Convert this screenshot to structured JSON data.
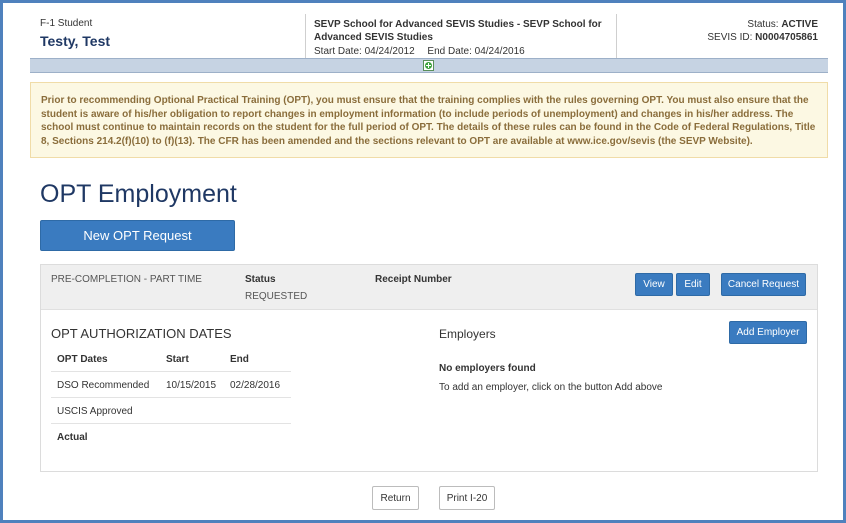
{
  "student": {
    "type": "F-1 Student",
    "name": "Testy, Test"
  },
  "school": {
    "name_line1": "SEVP School for Advanced SEVIS Studies - SEVP School for",
    "name_line2": "Advanced SEVIS Studies",
    "start_date": "Start Date: 04/24/2012",
    "end_date": "End Date: 04/24/2016"
  },
  "status": {
    "label": "Status:",
    "value": "ACTIVE",
    "sevis_label": "SEVIS ID:",
    "sevis_id": "N0004705861"
  },
  "notice": "Prior to recommending Optional Practical Training (OPT), you must ensure that the training complies with the rules governing OPT. You must also ensure that the student is aware of his/her obligation to report changes in employment information (to include periods of unemployment) and changes in his/her address. The school must continue to maintain records on the student for the full period of OPT. The details of these rules can be found in the Code of Federal Regulations, Title 8, Sections 214.2(f)(10) to (f)(13). The CFR has been amended and the sections relevant to OPT are available at www.ice.gov/sevis (the SEVP Website).",
  "page_title": "OPT Employment",
  "new_request_label": "New OPT Request",
  "request": {
    "type": "PRE-COMPLETION - PART TIME",
    "status_label": "Status",
    "status_value": "REQUESTED",
    "receipt_label": "Receipt Number",
    "view_label": "View",
    "edit_label": "Edit",
    "cancel_label": "Cancel Request"
  },
  "auth_dates": {
    "title": "OPT AUTHORIZATION DATES",
    "headers": [
      "OPT Dates",
      "Start",
      "End"
    ],
    "rows": [
      [
        "DSO Recommended",
        "10/15/2015",
        "02/28/2016"
      ],
      [
        "USCIS Approved",
        "",
        ""
      ],
      [
        "Actual",
        "",
        ""
      ]
    ]
  },
  "employers": {
    "title": "Employers",
    "add_label": "Add Employer",
    "empty_title": "No employers found",
    "empty_help": "To add an employer, click on the button Add above"
  },
  "footer": {
    "return_label": "Return",
    "print_label": "Print I-20"
  },
  "colors": {
    "frame": "#4f81bd",
    "primary": "#3a7bc0",
    "title": "#1f3864",
    "alert_bg": "#fcf8e3",
    "alert_text": "#8a6d3b"
  }
}
